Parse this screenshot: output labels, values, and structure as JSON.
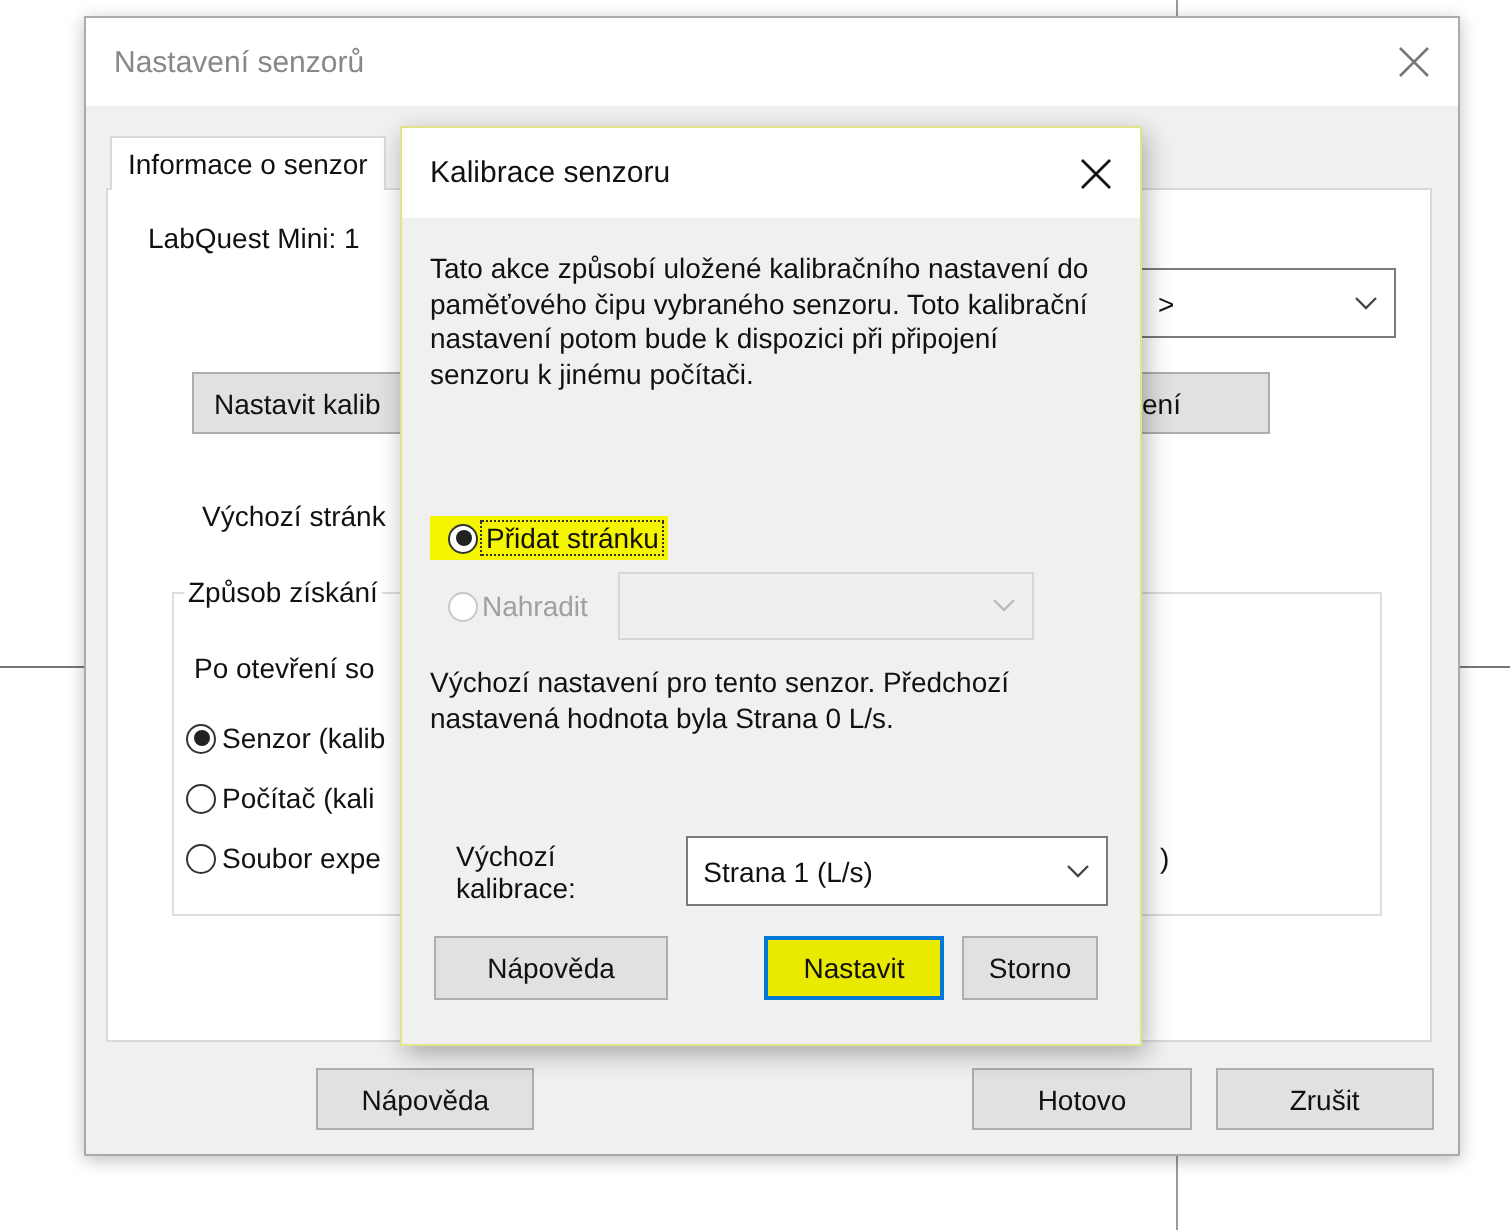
{
  "background_window": {
    "title": "Nastavení senzorů",
    "tabs": [
      {
        "label": "Informace o senzor",
        "selected": true
      }
    ],
    "device_label": "LabQuest Mini: 1",
    "dropdown": {
      "value": ">"
    },
    "calibrate_button": "Nastavit kalib",
    "right_button": "ení",
    "default_page_label": "Výchozí stránk",
    "group": {
      "title": "Způsob získání",
      "prompt": "Po otevření so",
      "options": [
        {
          "label": "Senzor (kalib",
          "selected": true
        },
        {
          "label": "Počítač (kali",
          "selected": false
        },
        {
          "label": "Soubor expe",
          "selected": false
        }
      ],
      "trailing_text": ")"
    },
    "buttons": [
      "Nápověda",
      "Hotovo",
      "Zrušit"
    ]
  },
  "dialog": {
    "title": "Kalibrace senzoru",
    "description": "Tato akce způsobí uložené kalibračního nastavení do paměťového čipu vybraného senzoru. Toto kalibrační nastavení potom bude k dispozici při připojení senzoru k jinému počítači.",
    "options": [
      {
        "kind": "plain",
        "label": "Přidat stránku",
        "selected": true,
        "disabled": false,
        "highlighted": true
      },
      {
        "kind": "with_dropdown",
        "label": "Nahradit",
        "selected": false,
        "disabled": true,
        "highlighted": false
      }
    ],
    "note": "Výchozí nastavení pro tento senzor. Předchozí nastavená hodnota byla Strana 0 L/s.",
    "default_calibration": {
      "label": "Výchozí kalibrace:",
      "value": "Strana 1 (L/s)"
    },
    "buttons": [
      {
        "label": "Nápověda",
        "default": false,
        "highlighted": false
      },
      {
        "label": "Nastavit",
        "default": true,
        "highlighted": true
      },
      {
        "label": "Storno",
        "default": false,
        "highlighted": false
      }
    ]
  }
}
